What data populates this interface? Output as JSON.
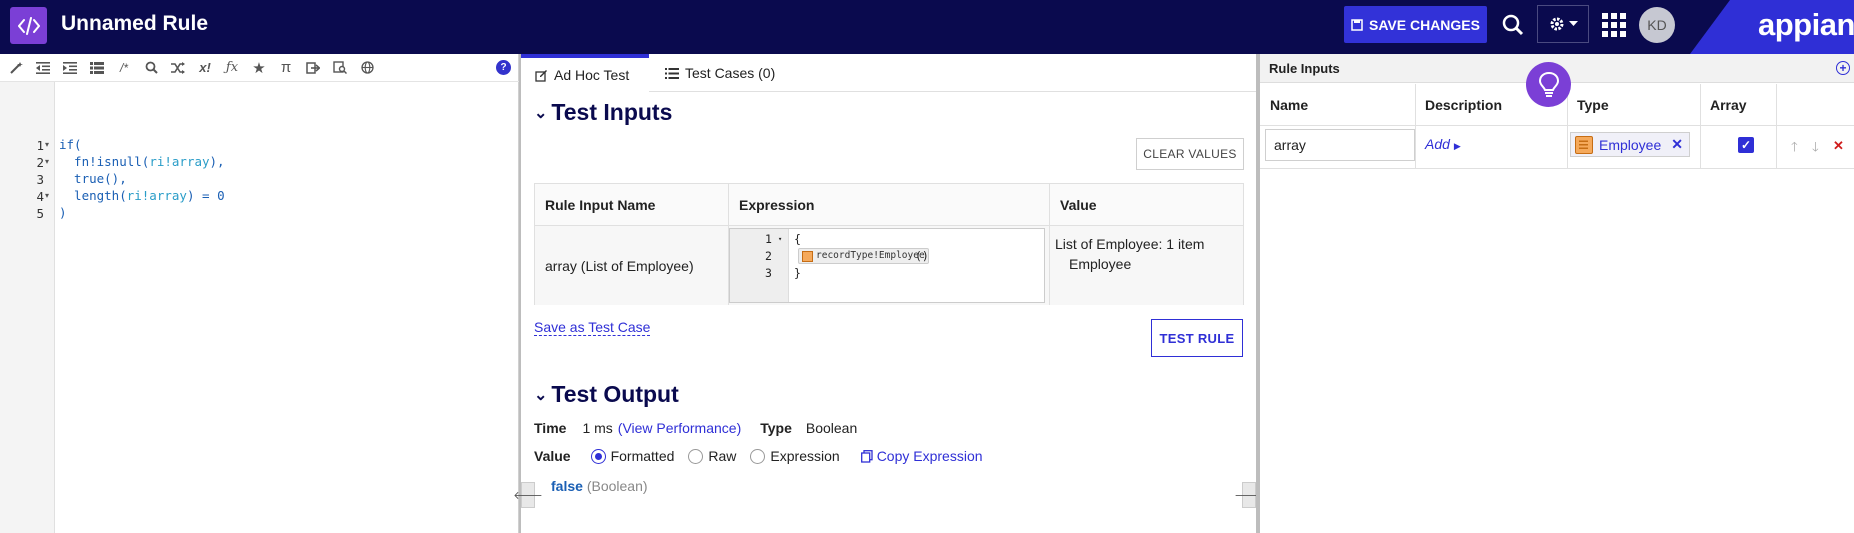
{
  "header": {
    "title": "Unnamed Rule",
    "save_label": "SAVE CHANGES",
    "avatar_initials": "KD",
    "brand": "appian",
    "colors": {
      "navy": "#0a0a4e",
      "accent": "#2f2fd6",
      "logo_tile": "#7b3fd6"
    }
  },
  "editor": {
    "toolbar_icons": [
      "magic-wand-icon",
      "outdent-icon",
      "indent-icon",
      "format-icon",
      "comment-icon",
      "search-icon",
      "shuffle-icon",
      "x-bang-icon",
      "fx-icon",
      "star-icon",
      "pi-icon",
      "export-icon",
      "find-records-icon",
      "globe-icon",
      "help-icon"
    ],
    "line_numbers": [
      "1",
      "2",
      "3",
      "4",
      "5"
    ],
    "lines": [
      {
        "parts": [
          {
            "t": "if(",
            "c": "kw"
          }
        ]
      },
      {
        "parts": [
          {
            "t": "  fn!isnull(",
            "c": "kw"
          },
          {
            "t": "ri!array",
            "c": "ri"
          },
          {
            "t": "),",
            "c": "kw"
          }
        ]
      },
      {
        "parts": [
          {
            "t": "  true(),",
            "c": "kw"
          }
        ]
      },
      {
        "parts": [
          {
            "t": "  length(",
            "c": "kw"
          },
          {
            "t": "ri!array",
            "c": "ri"
          },
          {
            "t": ") = ",
            "c": "kw"
          },
          {
            "t": "0",
            "c": "num"
          }
        ]
      },
      {
        "parts": [
          {
            "t": ")",
            "c": "kw"
          }
        ]
      }
    ]
  },
  "test_panel": {
    "tabs": [
      {
        "label": "Ad Hoc Test"
      },
      {
        "label": "Test Cases (0)"
      }
    ],
    "test_inputs_heading": "Test Inputs",
    "clear_values_label": "CLEAR VALUES",
    "table_headers": [
      "Rule Input Name",
      "Expression",
      "Value"
    ],
    "row": {
      "name": "array (List of Employee)",
      "expr_line_numbers": [
        "1",
        "2",
        "3"
      ],
      "expr_open": "{",
      "expr_token": "recordType!Employee",
      "expr_token_suffix": "()",
      "expr_close": "}",
      "value_line1": "List of Employee: 1 item",
      "value_line2": "Employee"
    },
    "save_as_test_case_label": "Save as Test Case",
    "test_rule_label": "TEST RULE",
    "test_output_heading": "Test Output",
    "time_label": "Time",
    "time_value": "1 ms",
    "view_performance_label": "(View Performance)",
    "type_label": "Type",
    "type_value": "Boolean",
    "value_label": "Value",
    "value_modes": [
      "Formatted",
      "Raw",
      "Expression"
    ],
    "selected_mode": "Formatted",
    "copy_expression_label": "Copy Expression",
    "result_value": "false",
    "result_type": "(Boolean)"
  },
  "rule_inputs": {
    "heading": "Rule Inputs",
    "headers": [
      "Name",
      "Description",
      "Type",
      "Array"
    ],
    "row": {
      "name": "array",
      "description_link": "Add",
      "type": "Employee",
      "array_checked": true
    }
  }
}
